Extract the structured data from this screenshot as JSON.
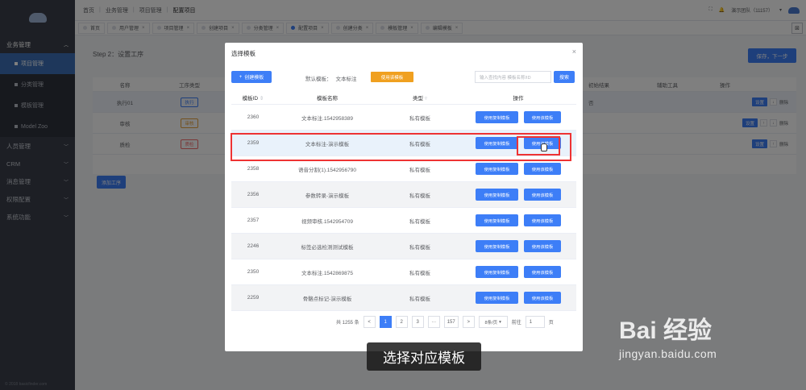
{
  "sidebar": {
    "groups": [
      {
        "label": "业务管理"
      },
      {
        "label": "人员管理"
      },
      {
        "label": "CRM"
      },
      {
        "label": "消息管理"
      },
      {
        "label": "权限配置"
      },
      {
        "label": "系统功能"
      }
    ],
    "items": [
      {
        "label": "项目管理"
      },
      {
        "label": "分类管理"
      },
      {
        "label": "模板管理"
      },
      {
        "label": "Model Zoo"
      }
    ],
    "copyright": "© 2018 basicfinder.com"
  },
  "topbar": {
    "crumbs": [
      "首页",
      "业务管理",
      "项目管理",
      "配置项目"
    ],
    "user": "演示团队（11157）"
  },
  "tabs": [
    "首页",
    "用户管理",
    "项目管理",
    "创建项目",
    "分类管理",
    "配置项目",
    "创建分类",
    "模板管理",
    "编辑模板"
  ],
  "page": {
    "step_title": "Step 2：设置工序",
    "next_button": "保存，下一步",
    "table_head": {
      "name": "名称",
      "type": "工序类型",
      "init_result": "初始结果",
      "tools": "辅助工具",
      "ops": "操作"
    },
    "rows": [
      {
        "name": "执行01",
        "tag": "执行",
        "init": "否"
      },
      {
        "name": "审核",
        "tag": "审核",
        "init": ""
      },
      {
        "name": "质检",
        "tag": "质检",
        "init": ""
      }
    ],
    "row_actions": {
      "settings": "设置",
      "delete": "删除"
    },
    "add_step": "添加工序"
  },
  "modal": {
    "title": "选择模板",
    "create_button": "创建模板",
    "default_label": "默认模板：",
    "default_value": "文本标注",
    "use_default_button": "使用该模板",
    "search_placeholder": "输入查找内容 模板名称/ID",
    "search_button": "搜索",
    "columns": {
      "id": "模板ID",
      "name": "模板名称",
      "type": "类型",
      "action": "操作"
    },
    "rows": [
      {
        "id": "2360",
        "name": "文本标注.1542958389",
        "type": "私有模板"
      },
      {
        "id": "2359",
        "name": "文本标注-演示模板",
        "type": "私有模板"
      },
      {
        "id": "2358",
        "name": "语音分割(1).1542956790",
        "type": "私有模板"
      },
      {
        "id": "2356",
        "name": "参数转录-演示模板",
        "type": "私有模板"
      },
      {
        "id": "2357",
        "name": "视频审核.1542954709",
        "type": "私有模板"
      },
      {
        "id": "2246",
        "name": "标签必选检测测试模板",
        "type": "私有模板"
      },
      {
        "id": "2350",
        "name": "文本标注.1542869875",
        "type": "私有模板"
      },
      {
        "id": "2259",
        "name": "骨骼点标记-演示模板",
        "type": "私有模板"
      }
    ],
    "action_copy": "使用复制模板",
    "action_use": "使用该模板",
    "pager": {
      "total": "共 1255 条",
      "pages": [
        "1",
        "2",
        "3",
        "···",
        "157"
      ],
      "page_size": "8条/页",
      "goto_label": "前往",
      "goto_value": "1",
      "page_unit": "页",
      "prev": "<",
      "next": ">"
    }
  },
  "caption": "选择对应模板",
  "watermark": {
    "brand": "Bai 经验",
    "url": "jingyan.baidu.com"
  }
}
